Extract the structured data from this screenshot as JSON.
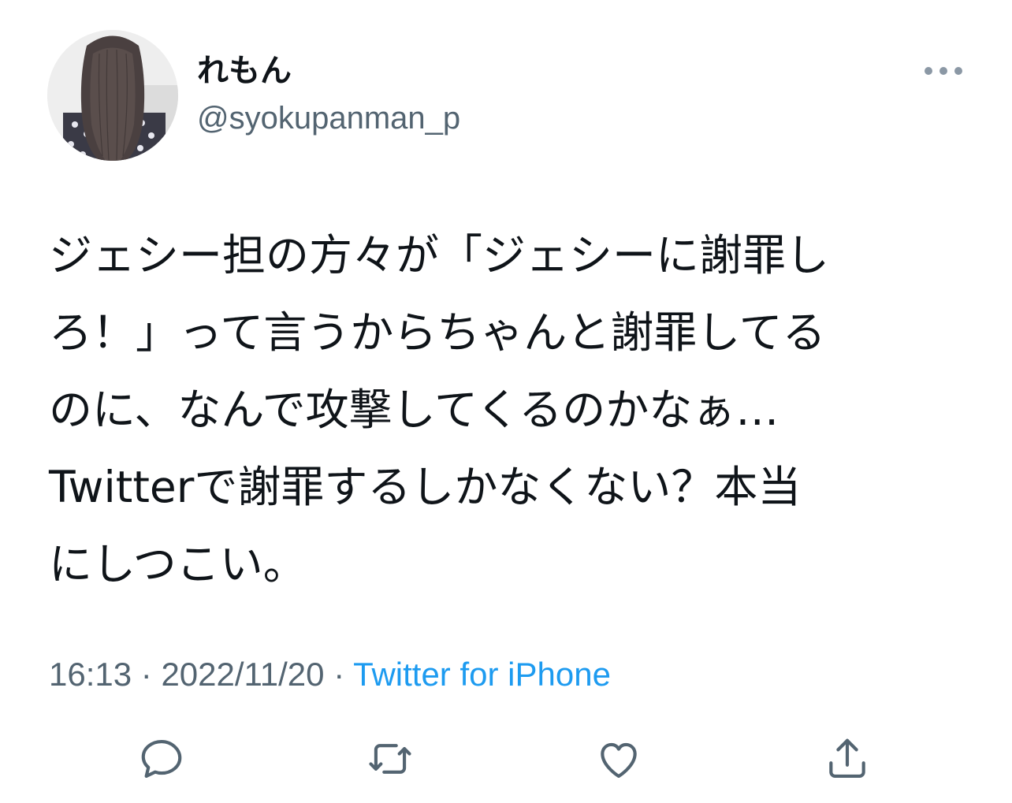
{
  "user": {
    "display_name": "れもん",
    "handle": "@syokupanman_p",
    "avatar_icon": "user-avatar"
  },
  "tweet": {
    "lines": [
      "ジェシー担の方々が「ジェシーに謝罪し",
      "ろ！」って言うからちゃんと謝罪してる",
      "のに、なんで攻撃してくるのかなぁ…",
      "Twitterで謝罪するしかなくない？本当",
      "にしつこい。"
    ]
  },
  "meta": {
    "time": "16:13",
    "separator1": " · ",
    "date": "2022/11/20",
    "separator2": " · ",
    "source": "Twitter for iPhone"
  },
  "icons": {
    "more": "more-horizontal-icon",
    "reply": "reply-icon",
    "retweet": "retweet-icon",
    "like": "heart-icon",
    "share": "share-icon"
  },
  "colors": {
    "text_primary": "#0f1419",
    "text_secondary": "#536471",
    "link": "#1d9bf0",
    "icon": "#536471"
  }
}
